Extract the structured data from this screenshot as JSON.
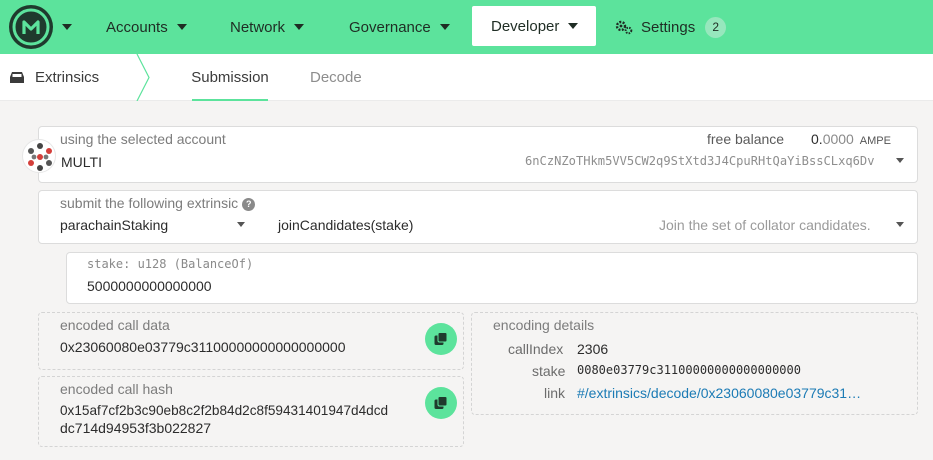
{
  "nav": {
    "items": [
      {
        "label": "Accounts"
      },
      {
        "label": "Network"
      },
      {
        "label": "Governance"
      },
      {
        "label": "Developer"
      },
      {
        "label": "Settings",
        "badge": "2"
      }
    ],
    "accent": "#5ce39c"
  },
  "subnav": {
    "section": "Extrinsics",
    "tabs": [
      {
        "label": "Submission",
        "active": true
      },
      {
        "label": "Decode",
        "active": false
      }
    ]
  },
  "account": {
    "label": "using the selected account",
    "name": "MULTI",
    "balance_label": "free balance",
    "balance_int": "0.",
    "balance_dec": "0000",
    "balance_unit": "AMPE",
    "address": "6nCzNZoTHkm5VV5CW2q9StXtd3J4CpuRHtQaYiBssCLxq6Dv"
  },
  "extrinsic": {
    "label": "submit the following extrinsic",
    "help": "?",
    "module": "parachainStaking",
    "method": "joinCandidates(stake)",
    "description": "Join the set of collator candidates."
  },
  "param": {
    "label": "stake: u128 (BalanceOf)",
    "value": "5000000000000000"
  },
  "call_data": {
    "label": "encoded call data",
    "value": "0x23060080e03779c31100000000000000000"
  },
  "call_hash": {
    "label": "encoded call hash",
    "line1": "0x15af7cf2b3c90eb8c2f2b84d2c8f59431401947d4dcd",
    "line2": "dc714d94953f3b022827"
  },
  "encoding": {
    "title": "encoding details",
    "call_index_label": "callIndex",
    "call_index": "2306",
    "stake_label": "stake",
    "stake": "0080e03779c31100000000000000000",
    "link_label": "link",
    "link": "#/extrinsics/decode/0x23060080e03779c31…"
  }
}
